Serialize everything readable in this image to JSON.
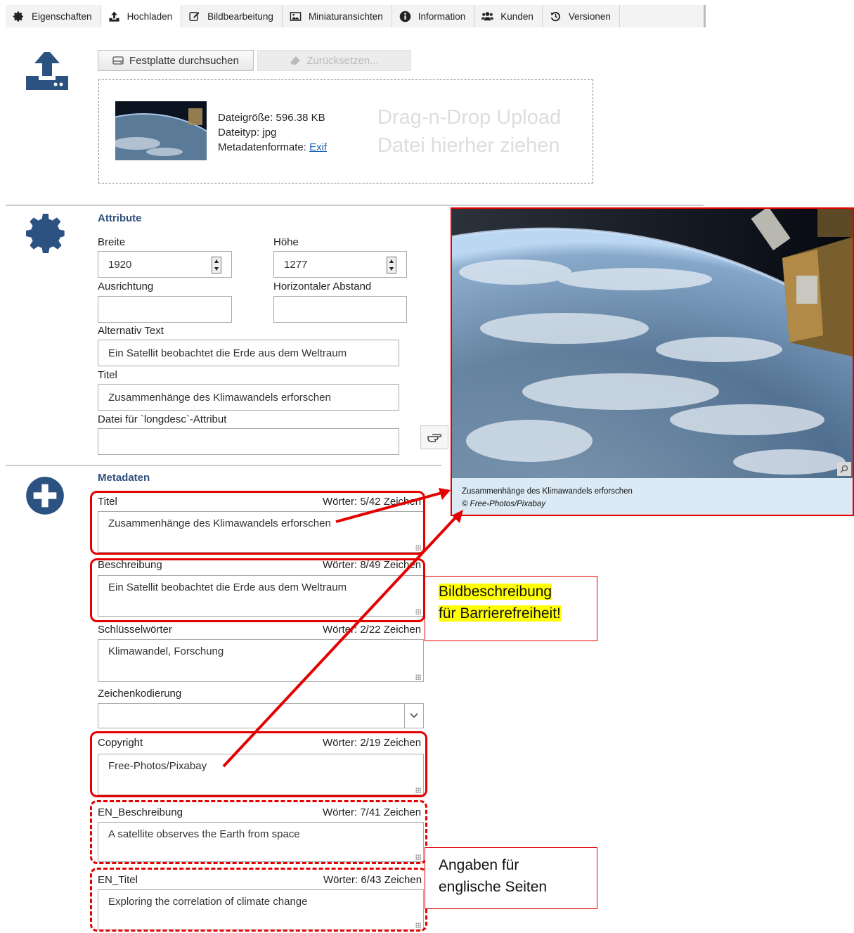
{
  "tabs": [
    {
      "label": "Eigenschaften",
      "icon": "gear-icon"
    },
    {
      "label": "Hochladen",
      "icon": "upload-icon"
    },
    {
      "label": "Bildbearbeitung",
      "icon": "edit-icon"
    },
    {
      "label": "Miniaturansichten",
      "icon": "image-icon"
    },
    {
      "label": "Information",
      "icon": "info-icon"
    },
    {
      "label": "Kunden",
      "icon": "users-icon"
    },
    {
      "label": "Versionen",
      "icon": "history-icon"
    }
  ],
  "upload": {
    "browse_label": "Festplatte durchsuchen",
    "reset_label": "Zurücksetzen...",
    "file_size": "Dateigröße: 596.38 KB",
    "file_type": "Dateityp: jpg",
    "meta_formats_label": "Metadatenformate: ",
    "meta_formats_link": "Exif",
    "dropzone_line1": "Drag-n-Drop Upload",
    "dropzone_line2": "Datei hierher ziehen"
  },
  "attributes": {
    "title": "Attribute",
    "width_label": "Breite",
    "width_value": "1920",
    "height_label": "Höhe",
    "height_value": "1277",
    "align_label": "Ausrichtung",
    "align_value": "",
    "hspace_label": "Horizontaler Abstand",
    "hspace_value": "",
    "alt_label": "Alternativ Text",
    "alt_value": "Ein Satellit beobachtet die Erde aus dem Weltraum",
    "title_label": "Titel",
    "title_value": "Zusammenhänge des Klimawandels erforschen",
    "longdesc_label": "Datei für `longdesc`-Attribut",
    "longdesc_value": ""
  },
  "metadata": {
    "title": "Metadaten",
    "fields": [
      {
        "label": "Titel",
        "count": "Wörter: 5/42 Zeichen",
        "value": "Zusammenhänge des Klimawandels erforschen"
      },
      {
        "label": "Beschreibung",
        "count": "Wörter: 8/49 Zeichen",
        "value": "Ein Satellit beobachtet die Erde aus dem Weltraum"
      },
      {
        "label": "Schlüsselwörter",
        "count": "Wörter: 2/22 Zeichen",
        "value": "Klimawandel, Forschung"
      },
      {
        "label": "Copyright",
        "count": "Wörter: 2/19 Zeichen",
        "value": "Free-Photos/Pixabay"
      },
      {
        "label": "EN_Beschreibung",
        "count": "Wörter: 7/41 Zeichen",
        "value": "A satellite observes the Earth from space"
      },
      {
        "label": "EN_Titel",
        "count": "Wörter: 6/43 Zeichen",
        "value": "Exploring the correlation of climate change"
      }
    ],
    "encoding_label": "Zeichenkodierung",
    "encoding_value": ""
  },
  "preview": {
    "caption": "Zusammenhänge des Klimawandels erforschen",
    "credit": "© Free-Photos/Pixabay"
  },
  "callouts": {
    "accessibility_line1": "Bildbeschreibung",
    "accessibility_line2": "für Barrierefreiheit!",
    "english_line1": "Angaben für",
    "english_line2": "englische Seiten"
  },
  "colors": {
    "icon_blue": "#2c5282",
    "annotation_red": "#e40000",
    "highlight": "#ffff00"
  }
}
